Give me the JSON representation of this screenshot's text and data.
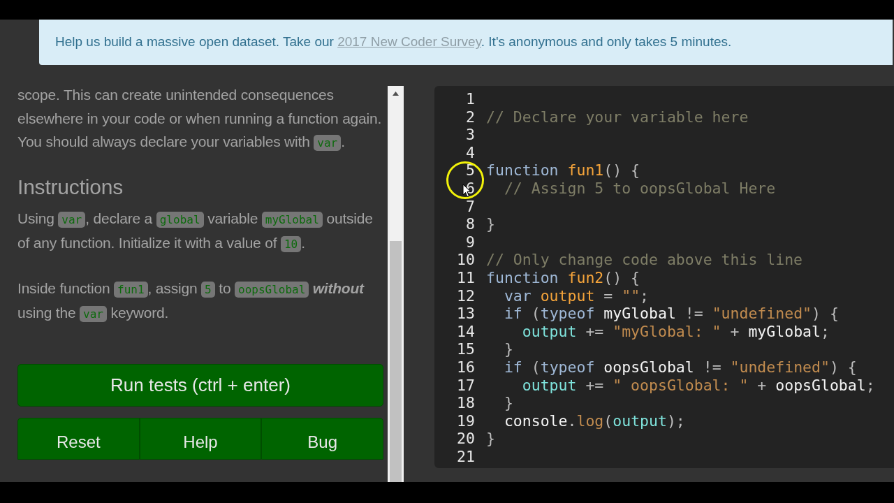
{
  "banner": {
    "text": "Help us build a massive open dataset. Take our ",
    "link": "2017 New Coder Survey",
    "after": ". It's anonymous and only takes 5 minutes."
  },
  "instructions": {
    "intro": [
      {
        "kind": "text",
        "text": "scope. This can create unintended consequences elsewhere in your code or when running a function again. You should always declare your variables with "
      },
      {
        "kind": "code",
        "text": "var"
      },
      {
        "kind": "text",
        "text": "."
      }
    ],
    "heading": "Instructions",
    "paragraphs": [
      [
        {
          "kind": "text",
          "text": "Using "
        },
        {
          "kind": "code",
          "text": "var"
        },
        {
          "kind": "text",
          "text": ", declare a "
        },
        {
          "kind": "code",
          "text": "global"
        },
        {
          "kind": "text",
          "text": " variable "
        },
        {
          "kind": "code",
          "text": "myGlobal"
        },
        {
          "kind": "text",
          "text": " outside of any function. Initialize it with a value of "
        },
        {
          "kind": "code",
          "text": "10"
        },
        {
          "kind": "text",
          "text": "."
        }
      ],
      [
        {
          "kind": "text",
          "text": "Inside function "
        },
        {
          "kind": "code",
          "text": "fun1"
        },
        {
          "kind": "text",
          "text": ", assign "
        },
        {
          "kind": "code",
          "text": "5"
        },
        {
          "kind": "text",
          "text": " to "
        },
        {
          "kind": "code",
          "text": "oopsGlobal"
        },
        {
          "kind": "em",
          "text": "without"
        },
        {
          "kind": "text",
          "text": " using the "
        },
        {
          "kind": "code",
          "text": "var"
        },
        {
          "kind": "text",
          "text": " keyword."
        }
      ]
    ]
  },
  "buttons": {
    "primary": "Run tests (ctrl + enter)",
    "secondary": [
      "Reset",
      "Help",
      "Bug"
    ]
  },
  "editor": {
    "lines": [
      {
        "number": "1"
      },
      {
        "number": "2",
        "tokens": [
          {
            "kind": "comment",
            "text": "// Declare your variable here"
          }
        ]
      },
      {
        "number": "3"
      },
      {
        "number": "4"
      },
      {
        "number": "5",
        "tokens": [
          {
            "kind": "keyword",
            "text": "function "
          },
          {
            "kind": "def",
            "text": "fun1"
          },
          {
            "kind": "plain",
            "text": "() {"
          }
        ]
      },
      {
        "number": "6",
        "tokens": [
          {
            "kind": "comment",
            "text": "  // Assign 5 to oopsGlobal Here"
          }
        ]
      },
      {
        "number": "7"
      },
      {
        "number": "8",
        "tokens": [
          {
            "kind": "plain",
            "text": "}"
          }
        ]
      },
      {
        "number": "9"
      },
      {
        "number": "10",
        "tokens": [
          {
            "kind": "comment",
            "text": "// Only change code above this line"
          }
        ]
      },
      {
        "number": "11",
        "tokens": [
          {
            "kind": "keyword",
            "text": "function "
          },
          {
            "kind": "def",
            "text": "fun2"
          },
          {
            "kind": "plain",
            "text": "() {"
          }
        ]
      },
      {
        "number": "12",
        "tokens": [
          {
            "kind": "keyword",
            "text": "  var "
          },
          {
            "kind": "def",
            "text": "output"
          },
          {
            "kind": "plain",
            "text": " = "
          },
          {
            "kind": "string",
            "text": "\"\""
          },
          {
            "kind": "plain",
            "text": ";"
          }
        ]
      },
      {
        "number": "13",
        "tokens": [
          {
            "kind": "keyword",
            "text": "  if "
          },
          {
            "kind": "plain",
            "text": "("
          },
          {
            "kind": "keyword",
            "text": "typeof "
          },
          {
            "kind": "global",
            "text": "myGlobal"
          },
          {
            "kind": "plain",
            "text": " != "
          },
          {
            "kind": "string",
            "text": "\"undefined\""
          },
          {
            "kind": "plain",
            "text": ") {"
          }
        ]
      },
      {
        "number": "14",
        "tokens": [
          {
            "kind": "variable",
            "text": "    output"
          },
          {
            "kind": "plain",
            "text": " += "
          },
          {
            "kind": "string",
            "text": "\"myGlobal: \""
          },
          {
            "kind": "plain",
            "text": " + "
          },
          {
            "kind": "global",
            "text": "myGlobal"
          },
          {
            "kind": "plain",
            "text": ";"
          }
        ]
      },
      {
        "number": "15",
        "tokens": [
          {
            "kind": "plain",
            "text": "  }"
          }
        ]
      },
      {
        "number": "16",
        "tokens": [
          {
            "kind": "keyword",
            "text": "  if "
          },
          {
            "kind": "plain",
            "text": "("
          },
          {
            "kind": "keyword",
            "text": "typeof "
          },
          {
            "kind": "global",
            "text": "oopsGlobal"
          },
          {
            "kind": "plain",
            "text": " != "
          },
          {
            "kind": "string",
            "text": "\"undefined\""
          },
          {
            "kind": "plain",
            "text": ") {"
          }
        ]
      },
      {
        "number": "17",
        "tokens": [
          {
            "kind": "variable",
            "text": "    output"
          },
          {
            "kind": "plain",
            "text": " += "
          },
          {
            "kind": "string",
            "text": "\" oopsGlobal: \""
          },
          {
            "kind": "plain",
            "text": " + "
          },
          {
            "kind": "global",
            "text": "oopsGlobal"
          },
          {
            "kind": "plain",
            "text": ";"
          }
        ]
      },
      {
        "number": "18",
        "tokens": [
          {
            "kind": "plain",
            "text": "  }"
          }
        ]
      },
      {
        "number": "19",
        "tokens": [
          {
            "kind": "global",
            "text": "  console"
          },
          {
            "kind": "plain",
            "text": "."
          },
          {
            "kind": "property",
            "text": "log"
          },
          {
            "kind": "plain",
            "text": "("
          },
          {
            "kind": "variable",
            "text": "output"
          },
          {
            "kind": "plain",
            "text": ");"
          }
        ]
      },
      {
        "number": "20",
        "tokens": [
          {
            "kind": "plain",
            "text": "}"
          }
        ]
      },
      {
        "number": "21"
      }
    ]
  }
}
